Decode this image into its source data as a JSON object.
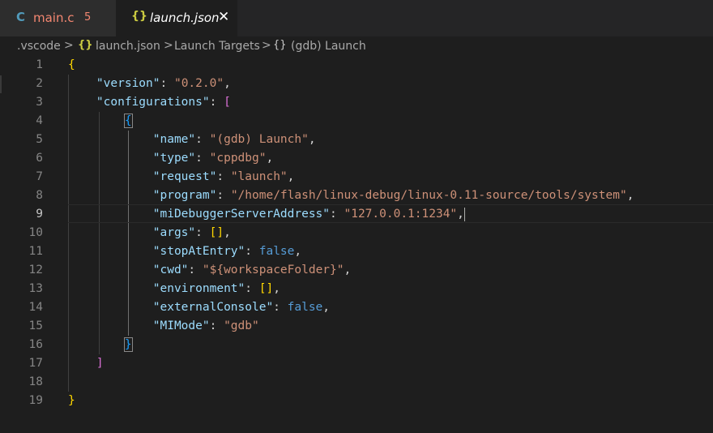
{
  "tabs": [
    {
      "icon": "C",
      "label": "main.c",
      "badge": "5"
    },
    {
      "icon": "{}",
      "label": "launch.json",
      "close": "✕"
    }
  ],
  "breadcrumb": [
    ".vscode",
    "launch.json",
    "Launch Targets",
    "(gdb) Launch"
  ],
  "breadcrumb_sep": ">",
  "breadcrumb_icons": {
    "json": "{}",
    "object": "{}"
  },
  "line_numbers": [
    "1",
    "2",
    "3",
    "4",
    "5",
    "6",
    "7",
    "8",
    "9",
    "10",
    "11",
    "12",
    "13",
    "14",
    "15",
    "16",
    "17",
    "18",
    "19"
  ],
  "code": {
    "l1": "{",
    "version_key": "\"version\"",
    "version_val": "\"0.2.0\"",
    "configurations_key": "\"configurations\"",
    "arr_open": "[",
    "obj_open": "{",
    "name_key": "\"name\"",
    "name_val": "\"(gdb) Launch\"",
    "type_key": "\"type\"",
    "type_val": "\"cppdbg\"",
    "request_key": "\"request\"",
    "request_val": "\"launch\"",
    "program_key": "\"program\"",
    "program_val": "\"/home/flash/linux-debug/linux-0.11-source/tools/system\"",
    "miserver_key": "\"miDebuggerServerAddress\"",
    "miserver_val": "\"127.0.0.1:1234\"",
    "args_key": "\"args\"",
    "args_val": "[]",
    "stop_key": "\"stopAtEntry\"",
    "stop_val": "false",
    "cwd_key": "\"cwd\"",
    "cwd_val": "\"${workspaceFolder}\"",
    "env_key": "\"environment\"",
    "env_val": "[]",
    "ext_key": "\"externalConsole\"",
    "ext_val": "false",
    "mimode_key": "\"MIMode\"",
    "mimode_val": "\"gdb\"",
    "obj_close": "}",
    "arr_close": "]",
    "l19": "}"
  },
  "colors": {
    "background": "#1e1e1e",
    "key": "#9cdcfe",
    "string": "#ce9178",
    "literal": "#569cd6",
    "bracket1": "#ffd700",
    "bracket2": "#da70d6",
    "bracket3": "#179fff"
  }
}
